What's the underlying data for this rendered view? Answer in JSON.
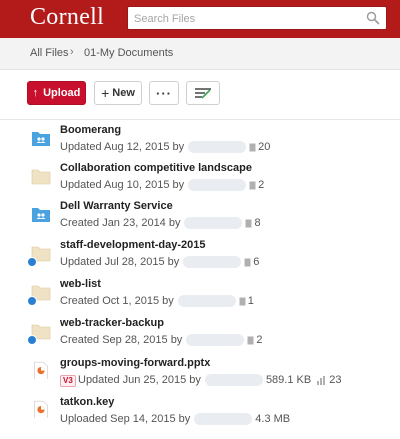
{
  "header": {
    "logo_text": "Cornell",
    "search_placeholder": "Search Files"
  },
  "breadcrumb": {
    "root": "All Files",
    "separator": "›",
    "current": "01-My Documents"
  },
  "toolbar": {
    "upload_label": "Upload",
    "new_label": "New",
    "more_label": "···"
  },
  "colors": {
    "brand_red": "#b31b1b",
    "upload_red": "#c8102e",
    "collab_folder_blue": "#4aa3df",
    "plain_folder_tan": "#f0e2c4"
  },
  "files": [
    {
      "name": "Boomerang",
      "meta": "Updated Aug 12, 2015 by",
      "count": "20",
      "icon": "collab-folder-icon"
    },
    {
      "name": "Collaboration competitive landscape",
      "meta": "Updated Aug 10, 2015 by",
      "count": "2",
      "icon": "folder-icon"
    },
    {
      "name": "Dell Warranty Service",
      "meta": "Created Jan 23, 2014 by",
      "count": "8",
      "icon": "collab-folder-icon"
    },
    {
      "name": "staff-development-day-2015",
      "meta": "Updated Jul 28, 2015 by",
      "count": "6",
      "icon": "synced-folder-icon"
    },
    {
      "name": "web-list",
      "meta": "Created Oct 1, 2015 by",
      "count": "1",
      "icon": "synced-folder-icon"
    },
    {
      "name": "web-tracker-backup",
      "meta": "Created Sep 28, 2015 by",
      "count": "2",
      "icon": "synced-folder-icon"
    },
    {
      "name": "groups-moving-forward.pptx",
      "meta": "Updated Jun 25, 2015 by",
      "size": "589.1 KB",
      "views": "23",
      "version": "V3",
      "icon": "presentation-file-icon"
    },
    {
      "name": "tatkon.key",
      "meta": "Uploaded Sep 14, 2015 by",
      "size": "4.3 MB",
      "icon": "presentation-file-icon"
    }
  ]
}
